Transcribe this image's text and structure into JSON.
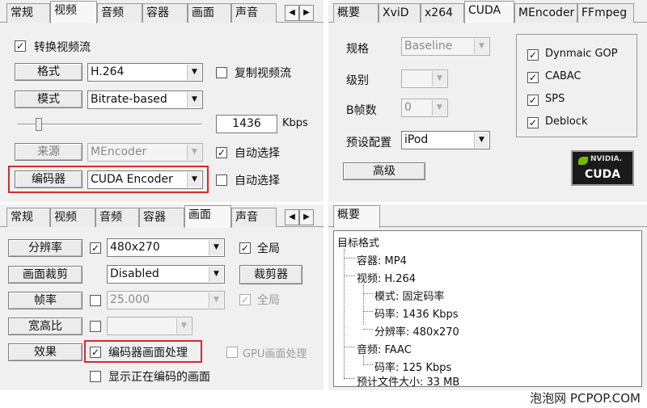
{
  "panel1": {
    "tabs": [
      "常规",
      "视频",
      "音频",
      "容器",
      "画面",
      "声音"
    ],
    "convert_video": "转换视频流",
    "format_btn": "格式",
    "format_value": "H.264",
    "copy_video": "复制视频流",
    "mode_btn": "模式",
    "mode_value": "Bitrate-based",
    "bitrate_value": "1436",
    "bitrate_unit": "Kbps",
    "source_btn": "来源",
    "source_value": "MEncoder",
    "auto_select_1": "自动选择",
    "encoder_btn": "编码器",
    "encoder_value": "CUDA Encoder",
    "auto_select_2": "自动选择",
    "slider_level": 0.1
  },
  "panel2": {
    "tabs": [
      "概要",
      "XviD",
      "x264",
      "CUDA",
      "MEncoder",
      "FFmpeg"
    ],
    "profile_label": "规格",
    "profile_value": "Baseline",
    "level_label": "级别",
    "bframes_label": "B帧数",
    "bframes_value": "0",
    "preset_label": "预设配置",
    "preset_value": "iPod",
    "advanced_btn": "高级",
    "options": [
      "Dynmaic GOP",
      "CABAC",
      "SPS",
      "Deblock"
    ],
    "nvidia_text": "NVIDIA.",
    "cuda_text": "CUDA"
  },
  "panel3": {
    "tabs": [
      "常规",
      "视频",
      "音频",
      "容器",
      "画面",
      "声音"
    ],
    "resolution_btn": "分辨率",
    "resolution_value": "480x270",
    "global_1": "全局",
    "crop_btn": "画面裁剪",
    "crop_value": "Disabled",
    "cropper_btn": "裁剪器",
    "framerate_btn": "帧率",
    "framerate_value": "25.000",
    "global_2": "全局",
    "aspect_btn": "宽高比",
    "effects_btn": "效果",
    "encoder_proc": "编码器画面处理",
    "gpu_proc": "GPU画面处理",
    "show_encoding": "显示正在编码的画面"
  },
  "panel4": {
    "tab": "概要",
    "tree": {
      "root": "目标格式",
      "container": "容器: MP4",
      "video": "视频: H.264",
      "mode": "模式: 固定码率",
      "vbitrate": "码率: 1436 Kbps",
      "resolution": "分辨率: 480x270",
      "audio": "音频: FAAC",
      "abitrate": "码率: 125 Kbps",
      "filesize": "预计文件大小: 33 MB"
    }
  },
  "watermark": "泡泡网 PCPOP.COM"
}
